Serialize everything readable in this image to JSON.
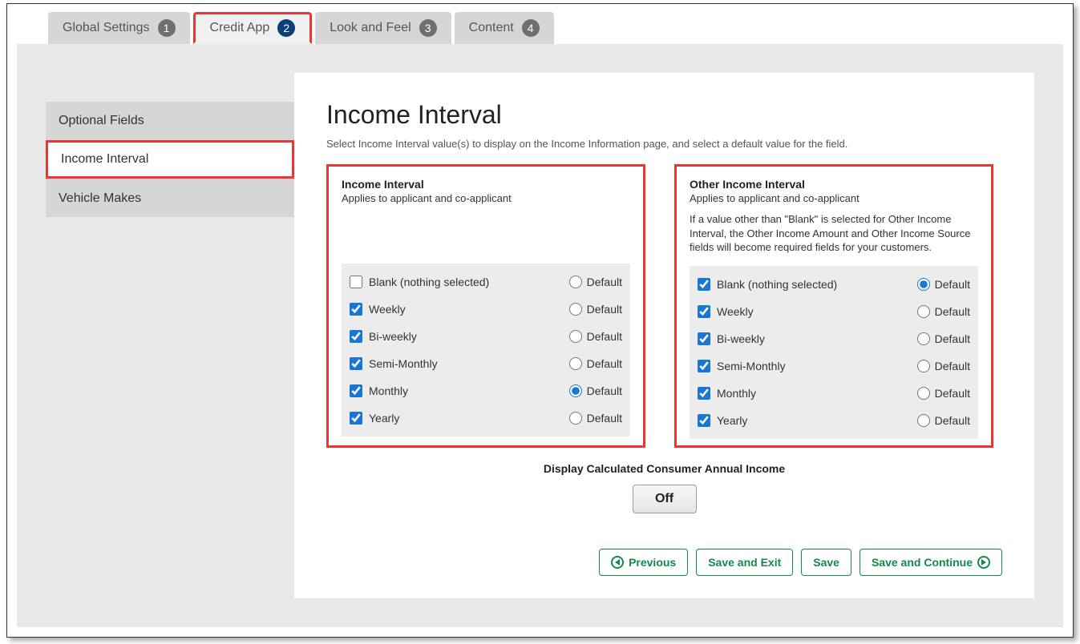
{
  "tabs": [
    {
      "label": "Global Settings",
      "number": "1",
      "active": false
    },
    {
      "label": "Credit App",
      "number": "2",
      "active": true
    },
    {
      "label": "Look and Feel",
      "number": "3",
      "active": false
    },
    {
      "label": "Content",
      "number": "4",
      "active": false
    }
  ],
  "sidebar": {
    "items": [
      {
        "label": "Optional Fields",
        "active": false
      },
      {
        "label": "Income Interval",
        "active": true
      },
      {
        "label": "Vehicle Makes",
        "active": false
      }
    ]
  },
  "main": {
    "title": "Income Interval",
    "description": "Select Income Interval value(s) to display on the Income Information page, and select a default value for the field.",
    "default_label": "Default",
    "panel1": {
      "title": "Income Interval",
      "subtitle": "Applies to applicant and co-applicant",
      "options": [
        {
          "label": "Blank (nothing selected)",
          "checked": false,
          "default": false
        },
        {
          "label": "Weekly",
          "checked": true,
          "default": false
        },
        {
          "label": "Bi-weekly",
          "checked": true,
          "default": false
        },
        {
          "label": "Semi-Monthly",
          "checked": true,
          "default": false
        },
        {
          "label": "Monthly",
          "checked": true,
          "default": true
        },
        {
          "label": "Yearly",
          "checked": true,
          "default": false
        }
      ]
    },
    "panel2": {
      "title": "Other Income Interval",
      "subtitle": "Applies to applicant and co-applicant",
      "note": "If a value other than \"Blank\" is selected for Other Income Interval, the Other Income Amount and Other Income Source fields will become required fields for your customers.",
      "options": [
        {
          "label": "Blank (nothing selected)",
          "checked": true,
          "default": true
        },
        {
          "label": "Weekly",
          "checked": true,
          "default": false
        },
        {
          "label": "Bi-weekly",
          "checked": true,
          "default": false
        },
        {
          "label": "Semi-Monthly",
          "checked": true,
          "default": false
        },
        {
          "label": "Monthly",
          "checked": true,
          "default": false
        },
        {
          "label": "Yearly",
          "checked": true,
          "default": false
        }
      ]
    },
    "toggle": {
      "label": "Display Calculated Consumer Annual Income",
      "state": "Off"
    }
  },
  "footer": {
    "previous": "Previous",
    "save_exit": "Save and Exit",
    "save": "Save",
    "save_continue": "Save and Continue"
  },
  "colors": {
    "highlight_border": "#e53935",
    "tab_active_badge": "#0b3e7a",
    "tab_inactive_badge": "#6f6f6f",
    "button_green": "#138a4a",
    "checkbox_accent": "#1976d2"
  }
}
